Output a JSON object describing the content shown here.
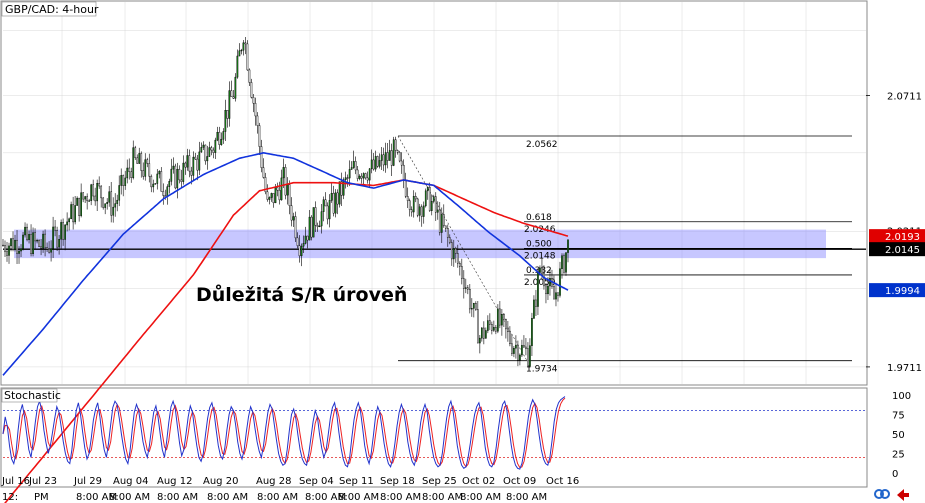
{
  "chart_data": {
    "type": "candlestick",
    "title": "GBP/CAD: 4-hour",
    "price_axis": {
      "ylim": [
        1.9648,
        2.1056
      ],
      "tick_labels": [
        "2.0711",
        "1.9711"
      ]
    },
    "price_badges": [
      {
        "label": "2.0193",
        "value": 2.0193,
        "bg": "#e00000",
        "fg": "#ffffff"
      },
      {
        "label": "2.0145",
        "value": 2.0145,
        "bg": "#000000",
        "fg": "#ffffff"
      },
      {
        "label": "1.9994",
        "value": 1.9994,
        "bg": "#0033cc",
        "fg": "#ffffff"
      }
    ],
    "partial_label": "2.0211",
    "support_resistance_zone": {
      "from": 2.0112,
      "to": 2.0217,
      "color": "#9999ff"
    },
    "horizontal_line": 2.0145,
    "annotation": "Důležitá S/R úroveň",
    "fibonacci": {
      "high": {
        "label": "2.0562",
        "value": 2.0562
      },
      "low": {
        "label": "1.9734",
        "value": 1.9734
      },
      "levels": [
        {
          "ratio": "0.618",
          "price": "2.0246",
          "value": 2.0246
        },
        {
          "ratio": "0.500",
          "price": "2.0148",
          "value": 2.0148
        },
        {
          "ratio": "0.382",
          "price": "2.0050",
          "value": 2.005
        }
      ]
    },
    "x_dates": [
      "Jul 16",
      "Jul 23",
      "Jul 29",
      "Aug 04",
      "Aug 12",
      "Aug 20",
      "Aug 28",
      "Sep 04",
      "Sep 11",
      "Sep 18",
      "Sep 25",
      "Oct 02",
      "Oct 09",
      "Oct 16"
    ],
    "x_times_partial": [
      "12:",
      "PM",
      "8:00 AM",
      "8:00 AM",
      "8:00 AM",
      "8:00 AM",
      "8:00 AM",
      "8:00 AM",
      "8:00 AM",
      "8:00 AM",
      "8:00 AM",
      "8:00 AM",
      "8:00 AM"
    ],
    "series_price_anchors": [
      [
        0,
        2.016
      ],
      [
        10,
        2.018
      ],
      [
        22,
        2.015
      ],
      [
        35,
        2.028
      ],
      [
        45,
        2.038
      ],
      [
        55,
        2.03
      ],
      [
        65,
        2.047
      ],
      [
        80,
        2.038
      ],
      [
        95,
        2.046
      ],
      [
        105,
        2.052
      ],
      [
        115,
        2.072
      ],
      [
        120,
        2.095
      ],
      [
        126,
        2.064
      ],
      [
        132,
        2.03
      ],
      [
        140,
        2.04
      ],
      [
        148,
        2.017
      ],
      [
        156,
        2.026
      ],
      [
        165,
        2.031
      ],
      [
        175,
        2.044
      ],
      [
        185,
        2.044
      ],
      [
        195,
        2.05
      ],
      [
        205,
        2.03
      ],
      [
        213,
        2.033
      ],
      [
        222,
        2.018
      ],
      [
        230,
        2.004
      ],
      [
        238,
        1.982
      ],
      [
        246,
        1.989
      ],
      [
        254,
        1.98
      ],
      [
        262,
        1.976
      ],
      [
        268,
        2.008
      ],
      [
        275,
        1.996
      ],
      [
        282,
        2.016
      ]
    ],
    "sma_blue": [
      [
        0,
        1.968
      ],
      [
        20,
        1.985
      ],
      [
        40,
        2.003
      ],
      [
        60,
        2.02
      ],
      [
        80,
        2.033
      ],
      [
        100,
        2.042
      ],
      [
        118,
        2.048
      ],
      [
        130,
        2.05
      ],
      [
        145,
        2.048
      ],
      [
        160,
        2.043
      ],
      [
        172,
        2.039
      ],
      [
        185,
        2.037
      ],
      [
        200,
        2.04
      ],
      [
        215,
        2.038
      ],
      [
        228,
        2.03
      ],
      [
        242,
        2.021
      ],
      [
        258,
        2.012
      ],
      [
        270,
        2.004
      ],
      [
        282,
        1.9994
      ]
    ],
    "sma_red": [
      [
        0,
        1.92
      ],
      [
        40,
        1.956
      ],
      [
        70,
        1.983
      ],
      [
        95,
        2.005
      ],
      [
        115,
        2.027
      ],
      [
        128,
        2.036
      ],
      [
        145,
        2.039
      ],
      [
        165,
        2.039
      ],
      [
        185,
        2.038
      ],
      [
        200,
        2.04
      ],
      [
        215,
        2.038
      ],
      [
        230,
        2.033
      ],
      [
        245,
        2.028
      ],
      [
        260,
        2.024
      ],
      [
        282,
        2.0193
      ]
    ],
    "stochastic": {
      "label": "Stochastic",
      "ylim": [
        0,
        100
      ],
      "tick_labels": [
        "100",
        "75",
        "50",
        "25",
        "0"
      ],
      "overbought": 80,
      "oversold": 20,
      "k": [
        50,
        72,
        60,
        35,
        18,
        12,
        25,
        55,
        78,
        88,
        72,
        50,
        30,
        20,
        40,
        65,
        85,
        92,
        80,
        55,
        38,
        25,
        35,
        52,
        70,
        85,
        78,
        60,
        40,
        25,
        15,
        12,
        30,
        58,
        80,
        90,
        75,
        52,
        32,
        18,
        25,
        45,
        68,
        82,
        90,
        72,
        48,
        30,
        20,
        38,
        62,
        84,
        92,
        88,
        70,
        50,
        32,
        18,
        12,
        28,
        55,
        78,
        88,
        80,
        60,
        40,
        28,
        20,
        35,
        58,
        78,
        86,
        72,
        50,
        30,
        20,
        40,
        65,
        85,
        92,
        82,
        60,
        38,
        22,
        30,
        50,
        72,
        86,
        78,
        55,
        35,
        20,
        15,
        25,
        48,
        70,
        84,
        90,
        78,
        55,
        35,
        22,
        18,
        32,
        55,
        75,
        85,
        80,
        62,
        40,
        25,
        18,
        30,
        52,
        72,
        85,
        78,
        58,
        40,
        28,
        20,
        35,
        58,
        78,
        88,
        82,
        62,
        42,
        25,
        15,
        10,
        12,
        30,
        55,
        75,
        82,
        70,
        48,
        30,
        18,
        12,
        10,
        25,
        45,
        66,
        80,
        72,
        50,
        32,
        20,
        28,
        48,
        70,
        84,
        90,
        75,
        52,
        32,
        18,
        10,
        8,
        20,
        45,
        68,
        82,
        90,
        80,
        58,
        35,
        20,
        12,
        25,
        48,
        72,
        85,
        78,
        58,
        38,
        22,
        12,
        8,
        18,
        38,
        60,
        78,
        88,
        80,
        62,
        40,
        25,
        15,
        10,
        20,
        42,
        65,
        80,
        88,
        78,
        55,
        35,
        20,
        12,
        8,
        10,
        25,
        48,
        70,
        85,
        92,
        80,
        58,
        35,
        20,
        10,
        6,
        8,
        20,
        38,
        58,
        75,
        85,
        90,
        78,
        55,
        32,
        18,
        10,
        8,
        14,
        32,
        55,
        75,
        88,
        92,
        80,
        58,
        36,
        20,
        10,
        6,
        5,
        12,
        28,
        50,
        72,
        86,
        94,
        88,
        70,
        48,
        30,
        18,
        12,
        10,
        20,
        42,
        66,
        82,
        90,
        94,
        96,
        98
      ],
      "d_offset": 2
    }
  }
}
